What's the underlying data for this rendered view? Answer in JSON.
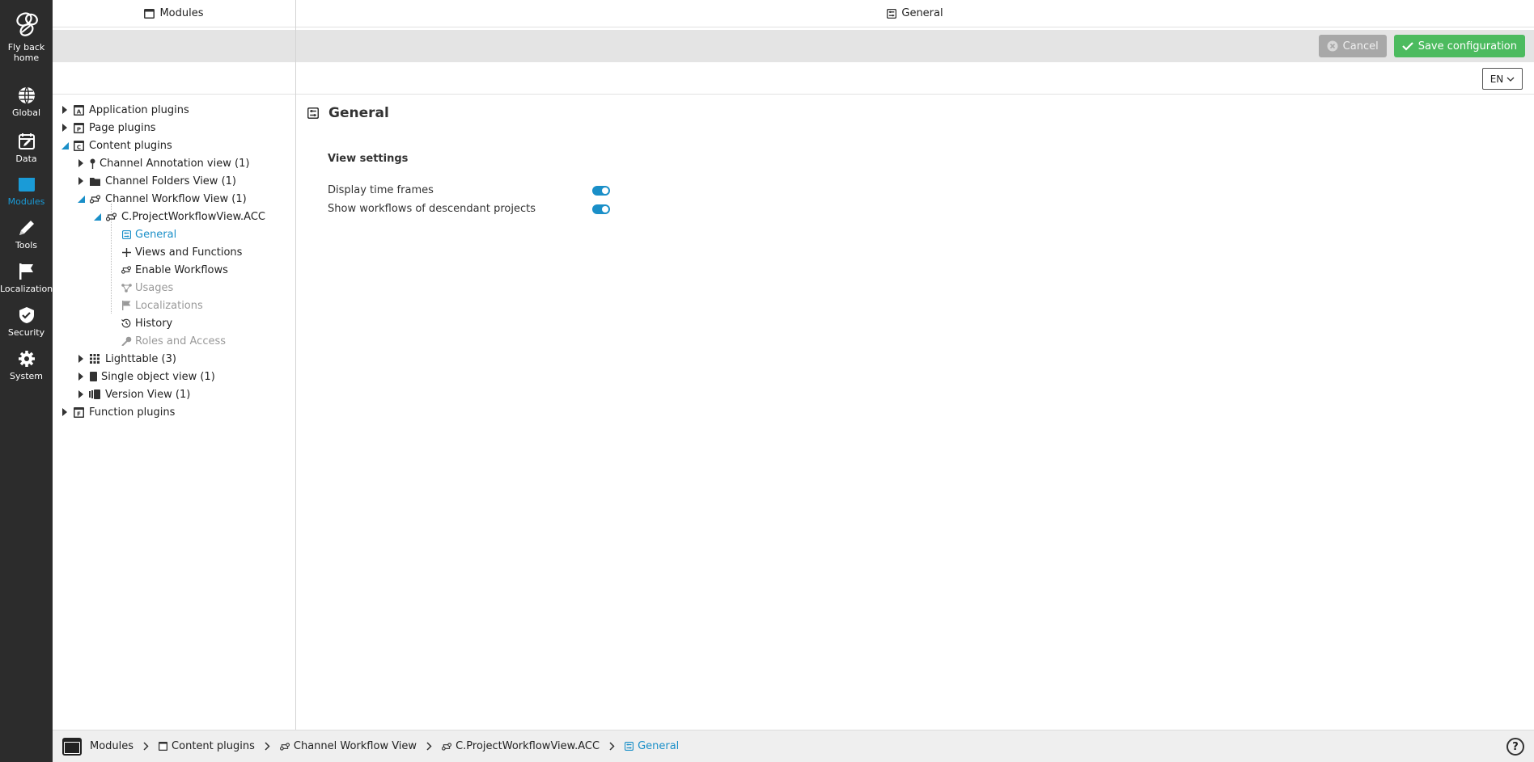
{
  "rail": {
    "items": [
      {
        "label": "Fly back home",
        "icon": "bee-logo-icon"
      },
      {
        "label": "Global",
        "icon": "globe-icon"
      },
      {
        "label": "Data",
        "icon": "calendar-edit-icon"
      },
      {
        "label": "Modules",
        "icon": "module-window-icon"
      },
      {
        "label": "Tools",
        "icon": "pencil-icon"
      },
      {
        "label": "Localization",
        "icon": "flag-icon"
      },
      {
        "label": "Security",
        "icon": "shield-icon"
      },
      {
        "label": "System",
        "icon": "gear-icon"
      }
    ],
    "active_color": "#1a9bd7"
  },
  "module_pane": {
    "title": "Modules",
    "tree": [
      {
        "label": "Application plugins"
      },
      {
        "label": "Page plugins"
      },
      {
        "label": "Content plugins"
      },
      {
        "label": "Channel Annotation view (1)"
      },
      {
        "label": "Channel Folders View (1)"
      },
      {
        "label": "Channel Workflow View (1)"
      },
      {
        "label": "C.ProjectWorkflowView.ACC"
      },
      {
        "label": "General"
      },
      {
        "label": "Views and Functions"
      },
      {
        "label": "Enable Workflows"
      },
      {
        "label": "Usages"
      },
      {
        "label": "Localizations"
      },
      {
        "label": "History"
      },
      {
        "label": "Roles and Access"
      },
      {
        "label": "Lighttable (3)"
      },
      {
        "label": "Single object view (1)"
      },
      {
        "label": "Version View (1)"
      },
      {
        "label": "Function plugins"
      }
    ]
  },
  "main": {
    "title": "General",
    "cancel_label": "Cancel",
    "save_label": "Save configuration",
    "language": "EN",
    "section_title": "General",
    "subheading": "View settings",
    "settings": [
      {
        "label": "Display time frames",
        "enabled": true
      },
      {
        "label": "Show workflows of descendant projects",
        "enabled": true
      }
    ]
  },
  "breadcrumb": {
    "items": [
      "Modules",
      "Content plugins",
      "Channel Workflow View",
      "C.ProjectWorkflowView.ACC",
      "General"
    ],
    "help": "?"
  },
  "colors": {
    "accent": "#1a8fc8",
    "save": "#4cbb5f",
    "rail_bg": "#2c2c2c"
  }
}
